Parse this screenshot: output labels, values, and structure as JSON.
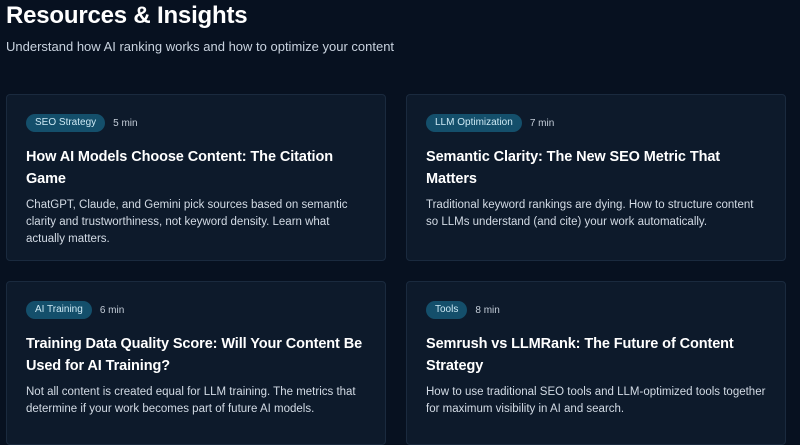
{
  "header": {
    "title": "Resources & Insights",
    "subtitle": "Understand how AI ranking works and how to optimize your content"
  },
  "articles": [
    {
      "category": "SEO Strategy",
      "read_time": "5 min",
      "title": "How AI Models Choose Content: The Citation Game",
      "description": "ChatGPT, Claude, and Gemini pick sources based on semantic clarity and trustworthiness, not keyword density. Learn what actually matters."
    },
    {
      "category": "LLM Optimization",
      "read_time": "7 min",
      "title": "Semantic Clarity: The New SEO Metric That Matters",
      "description": "Traditional keyword rankings are dying. How to structure content so LLMs understand (and cite) your work automatically."
    },
    {
      "category": "AI Training",
      "read_time": "6 min",
      "title": "Training Data Quality Score: Will Your Content Be Used for AI Training?",
      "description": "Not all content is created equal for LLM training. The metrics that determine if your work becomes part of future AI models."
    },
    {
      "category": "Tools",
      "read_time": "8 min",
      "title": "Semrush vs LLMRank: The Future of Content Strategy",
      "description": "How to use traditional SEO tools and LLM-optimized tools together for maximum visibility in AI and search."
    }
  ],
  "colors": {
    "background": "#071120",
    "card": "#0d1a2b",
    "badge": "#144f6b"
  }
}
